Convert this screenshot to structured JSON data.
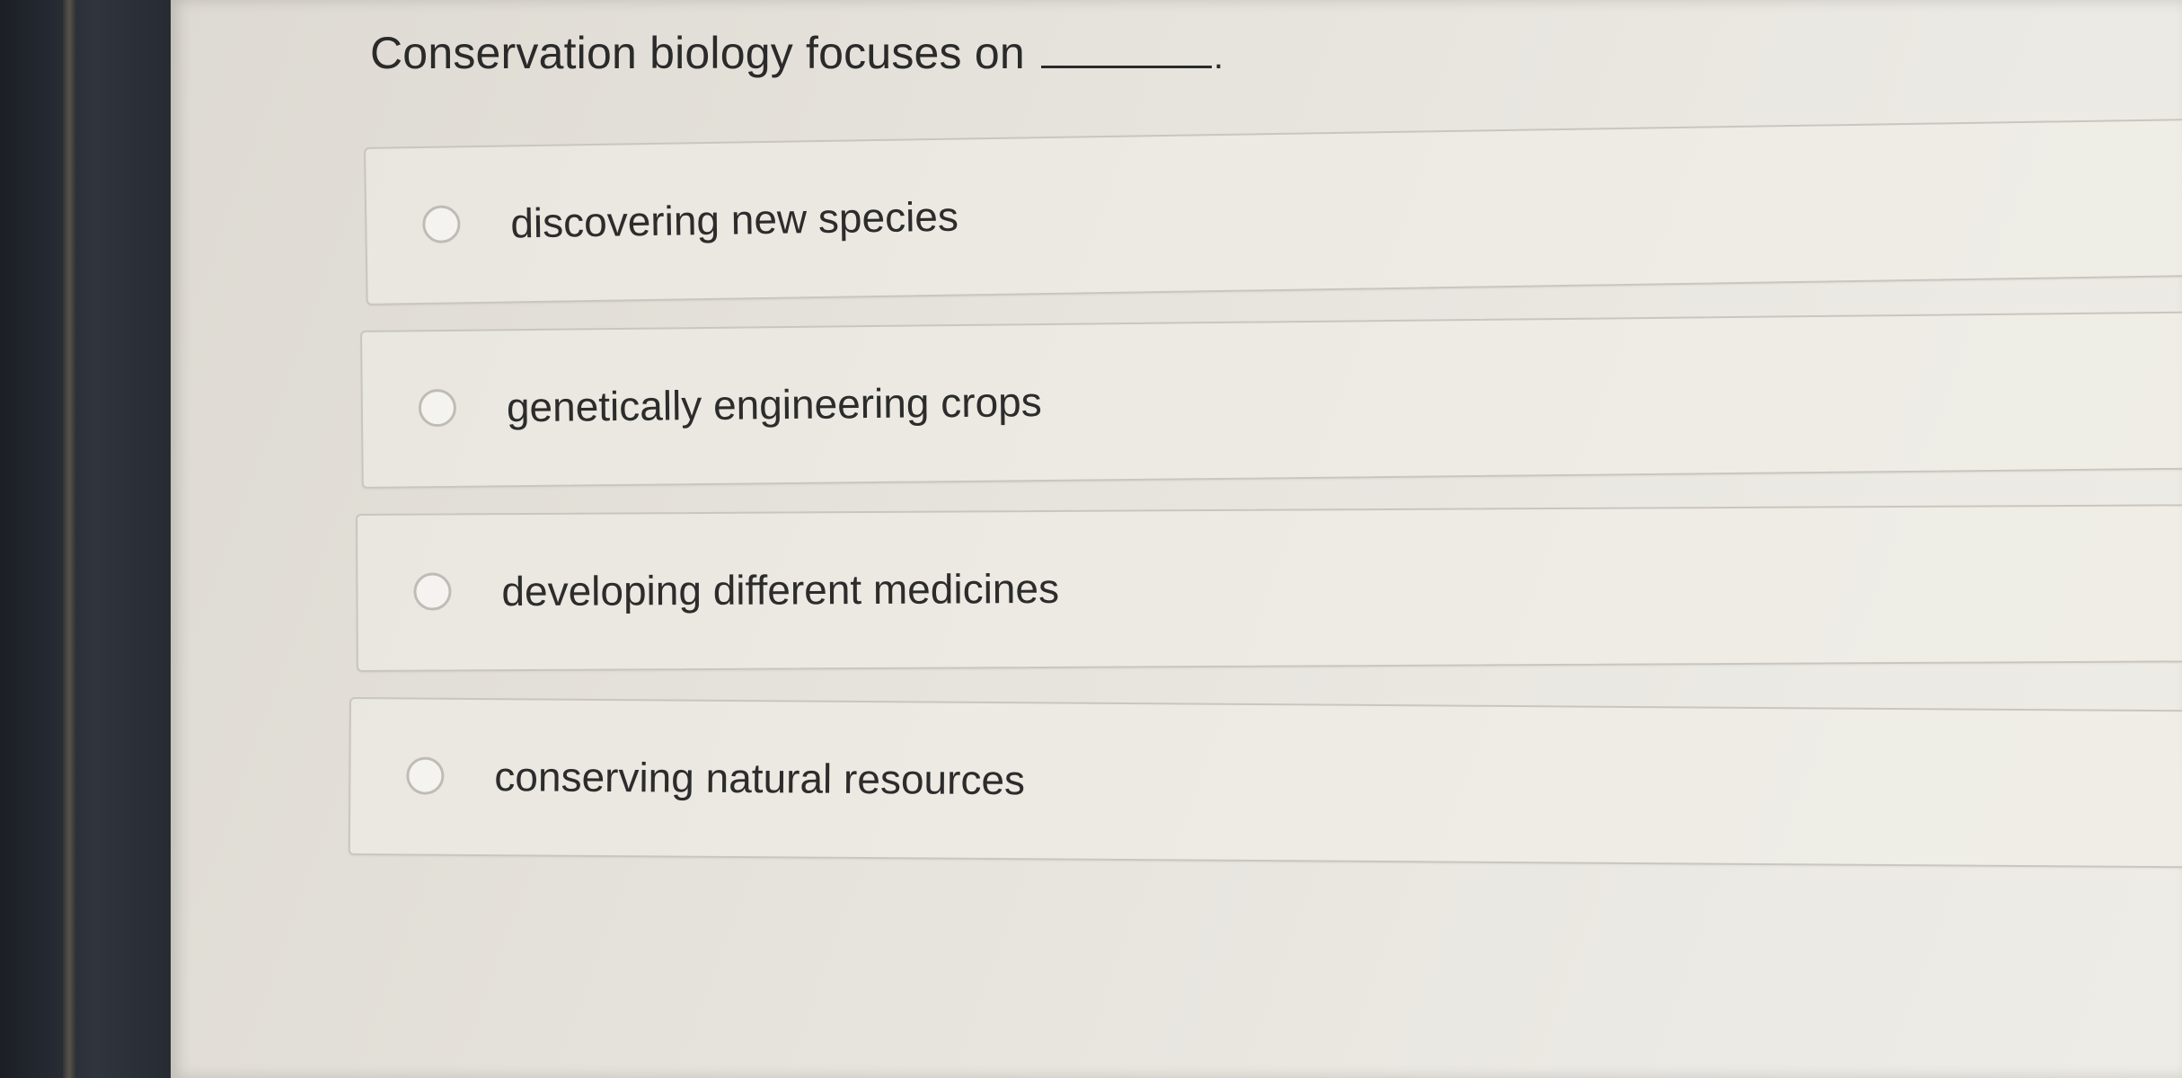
{
  "question": {
    "text": "Conservation biology focuses on",
    "end": "."
  },
  "options": [
    {
      "label": "discovering new species"
    },
    {
      "label": "genetically engineering crops"
    },
    {
      "label": "developing different medicines"
    },
    {
      "label": "conserving natural resources"
    }
  ]
}
